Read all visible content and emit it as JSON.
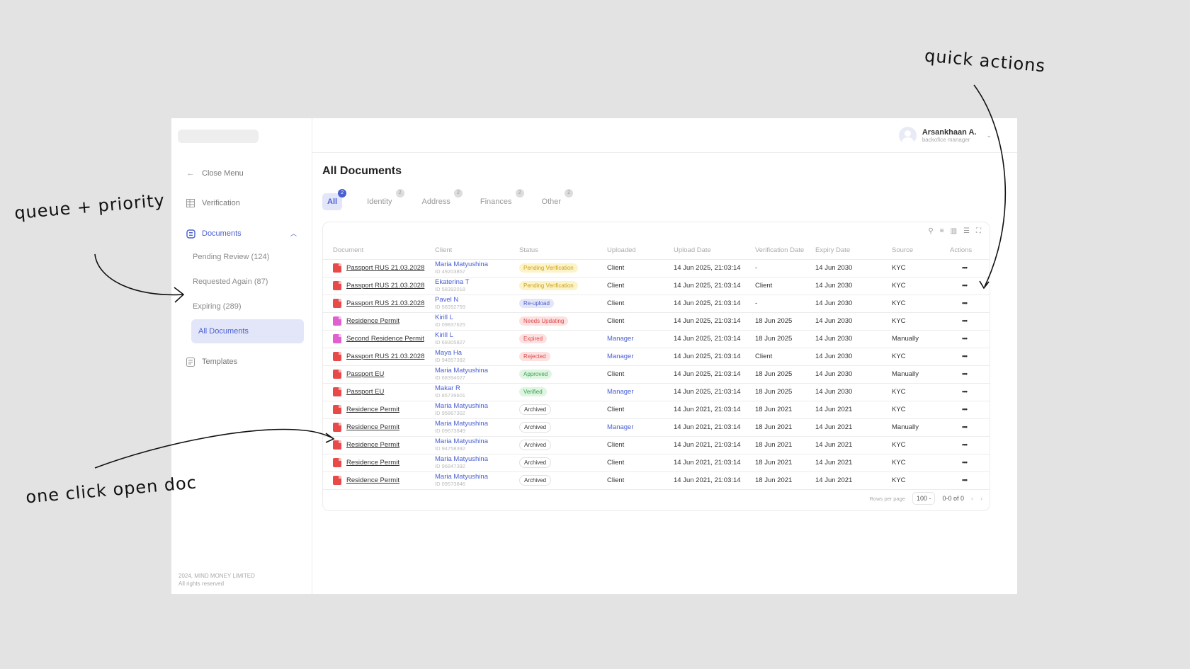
{
  "sidebar": {
    "close_menu": "Close Menu",
    "verification": "Verification",
    "documents": "Documents",
    "sub": [
      "Pending Review (124)",
      "Requested Again (87)",
      "Expiring (289)",
      "All Documents"
    ],
    "templates": "Templates",
    "footer_line1": "2024, MIND MONEY LIMITED",
    "footer_line2": "All rights reserved"
  },
  "user": {
    "name": "Arsankhaan A.",
    "role": "backofice manager"
  },
  "page_title": "All Documents",
  "tabs": [
    {
      "label": "All",
      "count": "2"
    },
    {
      "label": "Identity",
      "count": "2"
    },
    {
      "label": "Address",
      "count": "2"
    },
    {
      "label": "Finances",
      "count": "2"
    },
    {
      "label": "Other",
      "count": "2"
    }
  ],
  "table": {
    "columns": [
      "Document",
      "Client",
      "Status",
      "Uploaded",
      "Upload Date",
      "Verification Date",
      "Expiry Date",
      "Source",
      "Actions"
    ],
    "rows": [
      [
        "pdf",
        "Passport RUS 21.03.2028",
        "Maria Matyushina",
        "ID 49203857",
        "Pending Verification",
        "Client",
        "14 Jun 2025, 21:03:14",
        "-",
        "14 Jun 2030",
        "KYC"
      ],
      [
        "pdf",
        "Passport RUS 21.03.2028",
        "Ekaterina T",
        "ID 58392018",
        "Pending Verification",
        "Client",
        "14 Jun 2025, 21:03:14",
        "Client",
        "14 Jun 2030",
        "KYC"
      ],
      [
        "pdf",
        "Passport RUS 21.03.2028",
        "Pavel N",
        "ID 58392759",
        "Re-upload",
        "Client",
        "14 Jun 2025, 21:03:14",
        "-",
        "14 Jun 2030",
        "KYC"
      ],
      [
        "jpg",
        "Residence Permit",
        "Kirill L",
        "ID 09837625",
        "Needs Updating",
        "Client",
        "14 Jun 2025, 21:03:14",
        "18 Jun 2025",
        "14 Jun 2030",
        "KYC"
      ],
      [
        "jpg",
        "Second Residence Permit",
        "Kirill L",
        "ID 69305827",
        "Expired",
        "Manager",
        "14 Jun 2025, 21:03:14",
        "18 Jun 2025",
        "14 Jun 2030",
        "Manually"
      ],
      [
        "pdf",
        "Passport RUS 21.03.2028",
        "Maya Ha",
        "ID 94857392",
        "Rejected",
        "Manager",
        "14 Jun 2025, 21:03:14",
        "Client",
        "14 Jun 2030",
        "KYC"
      ],
      [
        "pdf",
        "Passport EU",
        "Maria Matyushina",
        "ID 68394027",
        "Approved",
        "Client",
        "14 Jun 2025, 21:03:14",
        "18 Jun 2025",
        "14 Jun 2030",
        "Manually"
      ],
      [
        "pdf",
        "Passport EU",
        "Makar R",
        "ID 85739601",
        "Verified",
        "Manager",
        "14 Jun 2025, 21:03:14",
        "18 Jun 2025",
        "14 Jun 2030",
        "KYC"
      ],
      [
        "pdf",
        "Residence Permit",
        "Maria Matyushina",
        "ID 95867302",
        "Archived",
        "Client",
        "14 Jun 2021, 21:03:14",
        "18 Jun 2021",
        "14 Jun 2021",
        "KYC"
      ],
      [
        "pdf",
        "Residence Permit",
        "Maria Matyushina",
        "ID 09673849",
        "Archived",
        "Manager",
        "14 Jun 2021, 21:03:14",
        "18 Jun 2021",
        "14 Jun 2021",
        "Manually"
      ],
      [
        "pdf",
        "Residence Permit",
        "Maria Matyushina",
        "ID 94758392",
        "Archived",
        "Client",
        "14 Jun 2021, 21:03:14",
        "18 Jun 2021",
        "14 Jun 2021",
        "KYC"
      ],
      [
        "pdf",
        "Residence Permit",
        "Maria Matyushina",
        "ID 96847392",
        "Archived",
        "Client",
        "14 Jun 2021, 21:03:14",
        "18 Jun 2021",
        "14 Jun 2021",
        "KYC"
      ],
      [
        "pdf",
        "Residence Permit",
        "Maria Matyushina",
        "ID 09573846",
        "Archived",
        "Client",
        "14 Jun 2021, 21:03:14",
        "18 Jun 2021",
        "14 Jun 2021",
        "KYC"
      ]
    ],
    "actions_glyph": "•••"
  },
  "status_colors": {
    "Pending Verification": [
      "#fdf3c8",
      "#c9a21a"
    ],
    "Re-upload": [
      "#e2e6f8",
      "#4a5fd0"
    ],
    "Needs Updating": [
      "#fde0e0",
      "#d94a4a"
    ],
    "Expired": [
      "#fde0e0",
      "#d94a4a"
    ],
    "Rejected": [
      "#fde0e0",
      "#d94a4a"
    ],
    "Approved": [
      "#def5e2",
      "#3a9e4e"
    ],
    "Verified": [
      "#def5e2",
      "#3a9e4e"
    ],
    "Archived": [
      "#ffffff",
      "#333333"
    ]
  },
  "file_colors": {
    "pdf": "#e84a4a",
    "jpg": "#e060d0"
  },
  "pagination": {
    "rows_per_page_label": "Rows per page",
    "rows_per_page": "100 -",
    "range": "0-0 of 0",
    "prev": "‹",
    "next": "›"
  },
  "annotations": {
    "quick_actions": "quick actions",
    "queue_priority": "queue + priority",
    "one_click": "one click open doc"
  }
}
